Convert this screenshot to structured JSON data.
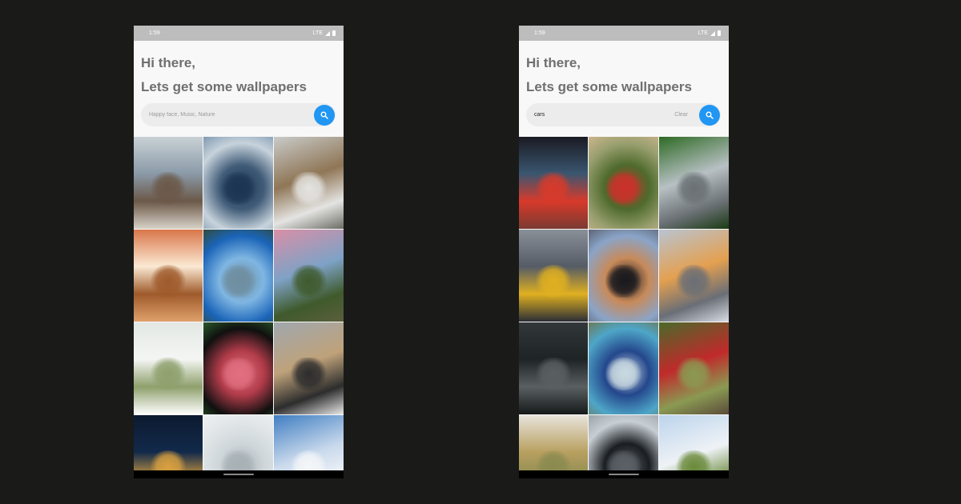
{
  "screens": [
    {
      "status": {
        "time": "1:59",
        "network": "LTE"
      },
      "greeting": {
        "line1": "Hi there,",
        "line2": "Lets get some wallpapers"
      },
      "search": {
        "value": "",
        "placeholder": "Happy face, Music, Nature",
        "clear_label": ""
      },
      "tiles": [
        {
          "subject": "wooden-cabin-under-clouds",
          "colors": [
            "#8a9aa8",
            "#c9d1d6",
            "#6b5848",
            "#d8d2c8"
          ]
        },
        {
          "subject": "storm-clouds-over-sea",
          "colors": [
            "#c7d3dc",
            "#415c78",
            "#1c3552",
            "#7f98b0"
          ]
        },
        {
          "subject": "small-bird-on-rock",
          "colors": [
            "#c9cbc9",
            "#8f7656",
            "#e4e4e2",
            "#6c6c66"
          ]
        },
        {
          "subject": "autumn-tree-in-fog",
          "colors": [
            "#fbe9d4",
            "#d9764a",
            "#9e5a2a",
            "#e0a16c"
          ]
        },
        {
          "subject": "coast-and-blue-sky",
          "colors": [
            "#1a64b8",
            "#7fb6e2",
            "#6f8ea0",
            "#314b3a"
          ]
        },
        {
          "subject": "lone-tree-at-sunset",
          "colors": [
            "#d98fa6",
            "#7ea2c6",
            "#3f5a2c",
            "#5b5f3c"
          ]
        },
        {
          "subject": "snowy-branch",
          "colors": [
            "#f4f6f4",
            "#e3e8e3",
            "#8ea06c",
            "#ffffff"
          ]
        },
        {
          "subject": "red-tulip",
          "colors": [
            "#101010",
            "#b23c4a",
            "#e06e7e",
            "#2a5a2a"
          ]
        },
        {
          "subject": "zebra-in-grassland",
          "colors": [
            "#a0a8ae",
            "#bfa27a",
            "#2d2d2d",
            "#e9e9e9"
          ]
        },
        {
          "subject": "city-lights-at-night",
          "colors": [
            "#12294a",
            "#0c1a30",
            "#d8a040",
            "#3a4e70"
          ]
        },
        {
          "subject": "misty-white-sky",
          "colors": [
            "#e2e6e8",
            "#ced6da",
            "#a7b1b6",
            "#eef1f2"
          ]
        },
        {
          "subject": "snowy-mountains",
          "colors": [
            "#3f7ec2",
            "#c9d9ec",
            "#f4f6f8",
            "#2d5a8a"
          ]
        }
      ]
    },
    {
      "status": {
        "time": "1:59",
        "network": "LTE"
      },
      "greeting": {
        "line1": "Hi there,",
        "line2": "Lets get some wallpapers"
      },
      "search": {
        "value": "cars",
        "placeholder": "Happy face, Music, Nature",
        "clear_label": "Clear"
      },
      "tiles": [
        {
          "subject": "car-tail-lights-in-traffic",
          "colors": [
            "#3a5670",
            "#1a1a22",
            "#d83a2a",
            "#7a3a32"
          ]
        },
        {
          "subject": "red-classic-convertible",
          "colors": [
            "#9aa070",
            "#4e6a2c",
            "#c8322a",
            "#cdb48c"
          ]
        },
        {
          "subject": "silver-sports-car",
          "colors": [
            "#2e6a24",
            "#b8c0c4",
            "#6a7074",
            "#1a3a14"
          ]
        },
        {
          "subject": "city-street-traffic",
          "colors": [
            "#555c66",
            "#8a9098",
            "#e0b020",
            "#2a2e36"
          ]
        },
        {
          "subject": "black-muscle-car",
          "colors": [
            "#8aa4c8",
            "#c88a5a",
            "#1a1a1e",
            "#5c6474"
          ]
        },
        {
          "subject": "orange-supercar-on-beach",
          "colors": [
            "#b8c4d2",
            "#e4a050",
            "#6a6e76",
            "#d8dde4"
          ]
        },
        {
          "subject": "highway-from-above",
          "colors": [
            "#1e2426",
            "#32383a",
            "#5a6062",
            "#141818"
          ]
        },
        {
          "subject": "blue-ferrari",
          "colors": [
            "#4ea6c8",
            "#24478c",
            "#c8d8e0",
            "#6a7a5a"
          ]
        },
        {
          "subject": "small-red-fiat",
          "colors": [
            "#4a6a2a",
            "#c02a2a",
            "#8a9a52",
            "#5a4a3a"
          ]
        },
        {
          "subject": "sneakers-on-dashboard",
          "colors": [
            "#b8a060",
            "#e8e4dc",
            "#8a8a50",
            "#d4c8a0"
          ]
        },
        {
          "subject": "black-audi",
          "colors": [
            "#c8cfd4",
            "#1a1e22",
            "#5a6066",
            "#9aa2a8"
          ]
        },
        {
          "subject": "hat-out-of-car-window",
          "colors": [
            "#bcd4ec",
            "#eef2f6",
            "#6a8a3a",
            "#d8c8a0"
          ]
        }
      ]
    }
  ]
}
